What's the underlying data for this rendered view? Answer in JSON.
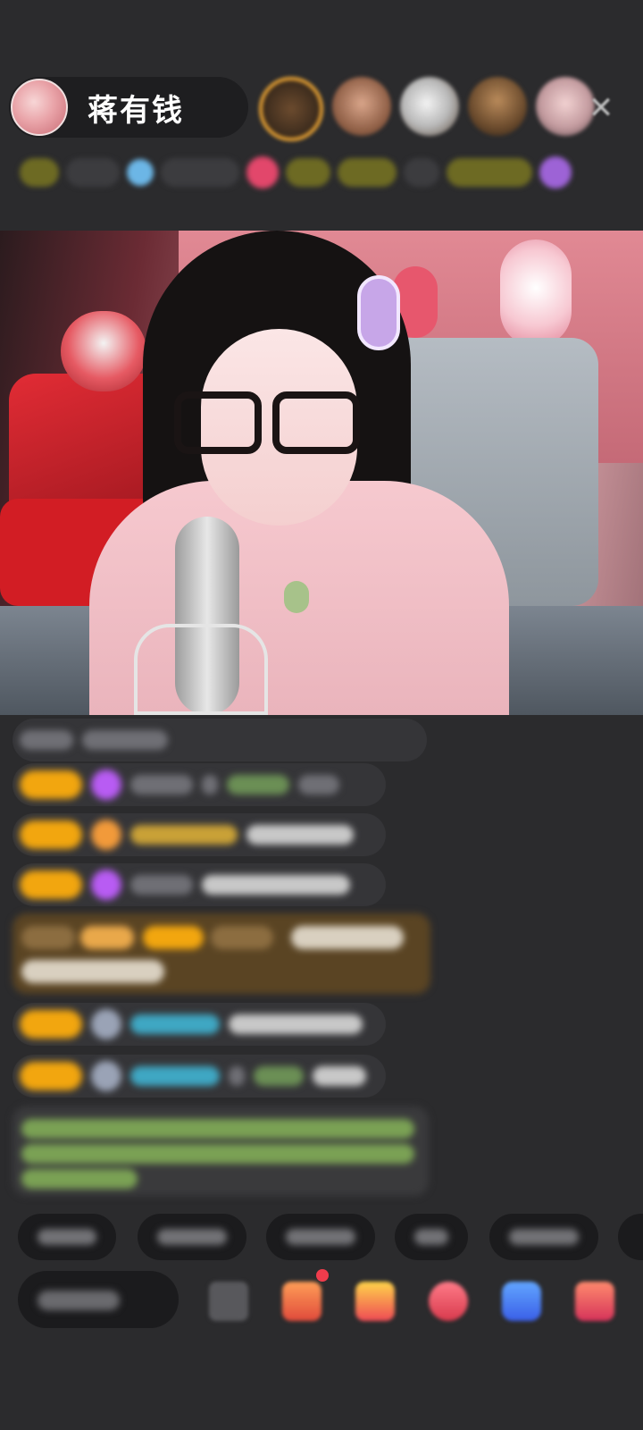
{
  "header": {
    "host_name": "蒋有钱",
    "close_icon": "close-icon",
    "viewer_avatars": [
      "viewer-avatar-1",
      "viewer-avatar-2",
      "viewer-avatar-3",
      "viewer-avatar-4",
      "viewer-avatar-5"
    ]
  },
  "colors": {
    "background": "#2b2b2d",
    "level_badge": "#f2a60f",
    "highlight_message": "#5a4423",
    "username_cyan": "#3fa7c3",
    "system_message_green": "#7aa154"
  },
  "icons": {
    "close": "close-icon",
    "emoji": "emoji-icon",
    "gift_buttons": [
      "gift-icon",
      "treasure-box-icon",
      "heart-icon",
      "game-icon",
      "more-icon"
    ]
  }
}
